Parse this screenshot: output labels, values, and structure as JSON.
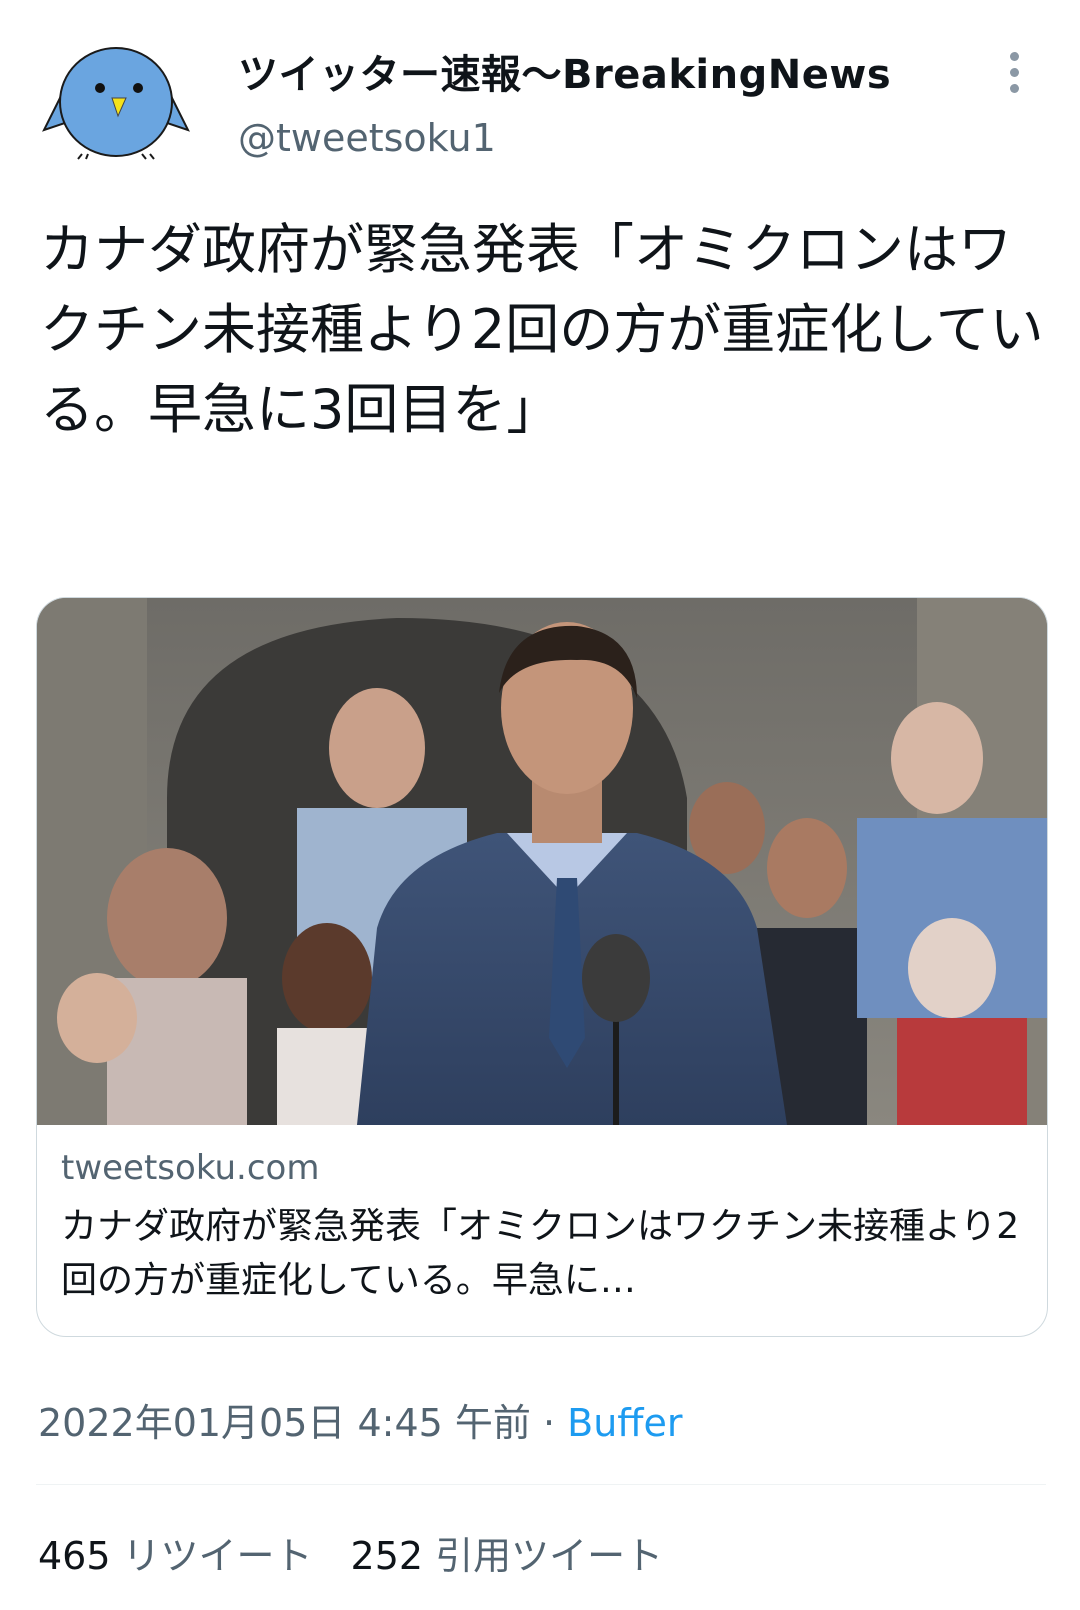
{
  "author": {
    "display_name": "ツイッター速報〜BreakingNews",
    "handle": "@tweetsoku1",
    "avatar_icon": "blue-bird-icon"
  },
  "tweet": {
    "text": "カナダ政府が緊急発表「オミクロンはワクチン未接種より2回の方が重症化している。早急に3回目を」"
  },
  "card": {
    "domain": "tweetsoku.com",
    "title": "カナダ政府が緊急発表「オミクロンはワクチン未接種より2回の方が重症化している。早急に…"
  },
  "meta": {
    "timestamp": "2022年01月05日 4:45 午前",
    "separator": " · ",
    "source": "Buffer"
  },
  "stats": {
    "retweets_count": "465",
    "retweets_label": "リツイート",
    "quotes_count": "252",
    "quotes_label": "引用ツイート"
  },
  "colors": {
    "accent": "#1d9bf0",
    "secondary_text": "#536471",
    "avatar_blue": "#6aa5e0"
  }
}
